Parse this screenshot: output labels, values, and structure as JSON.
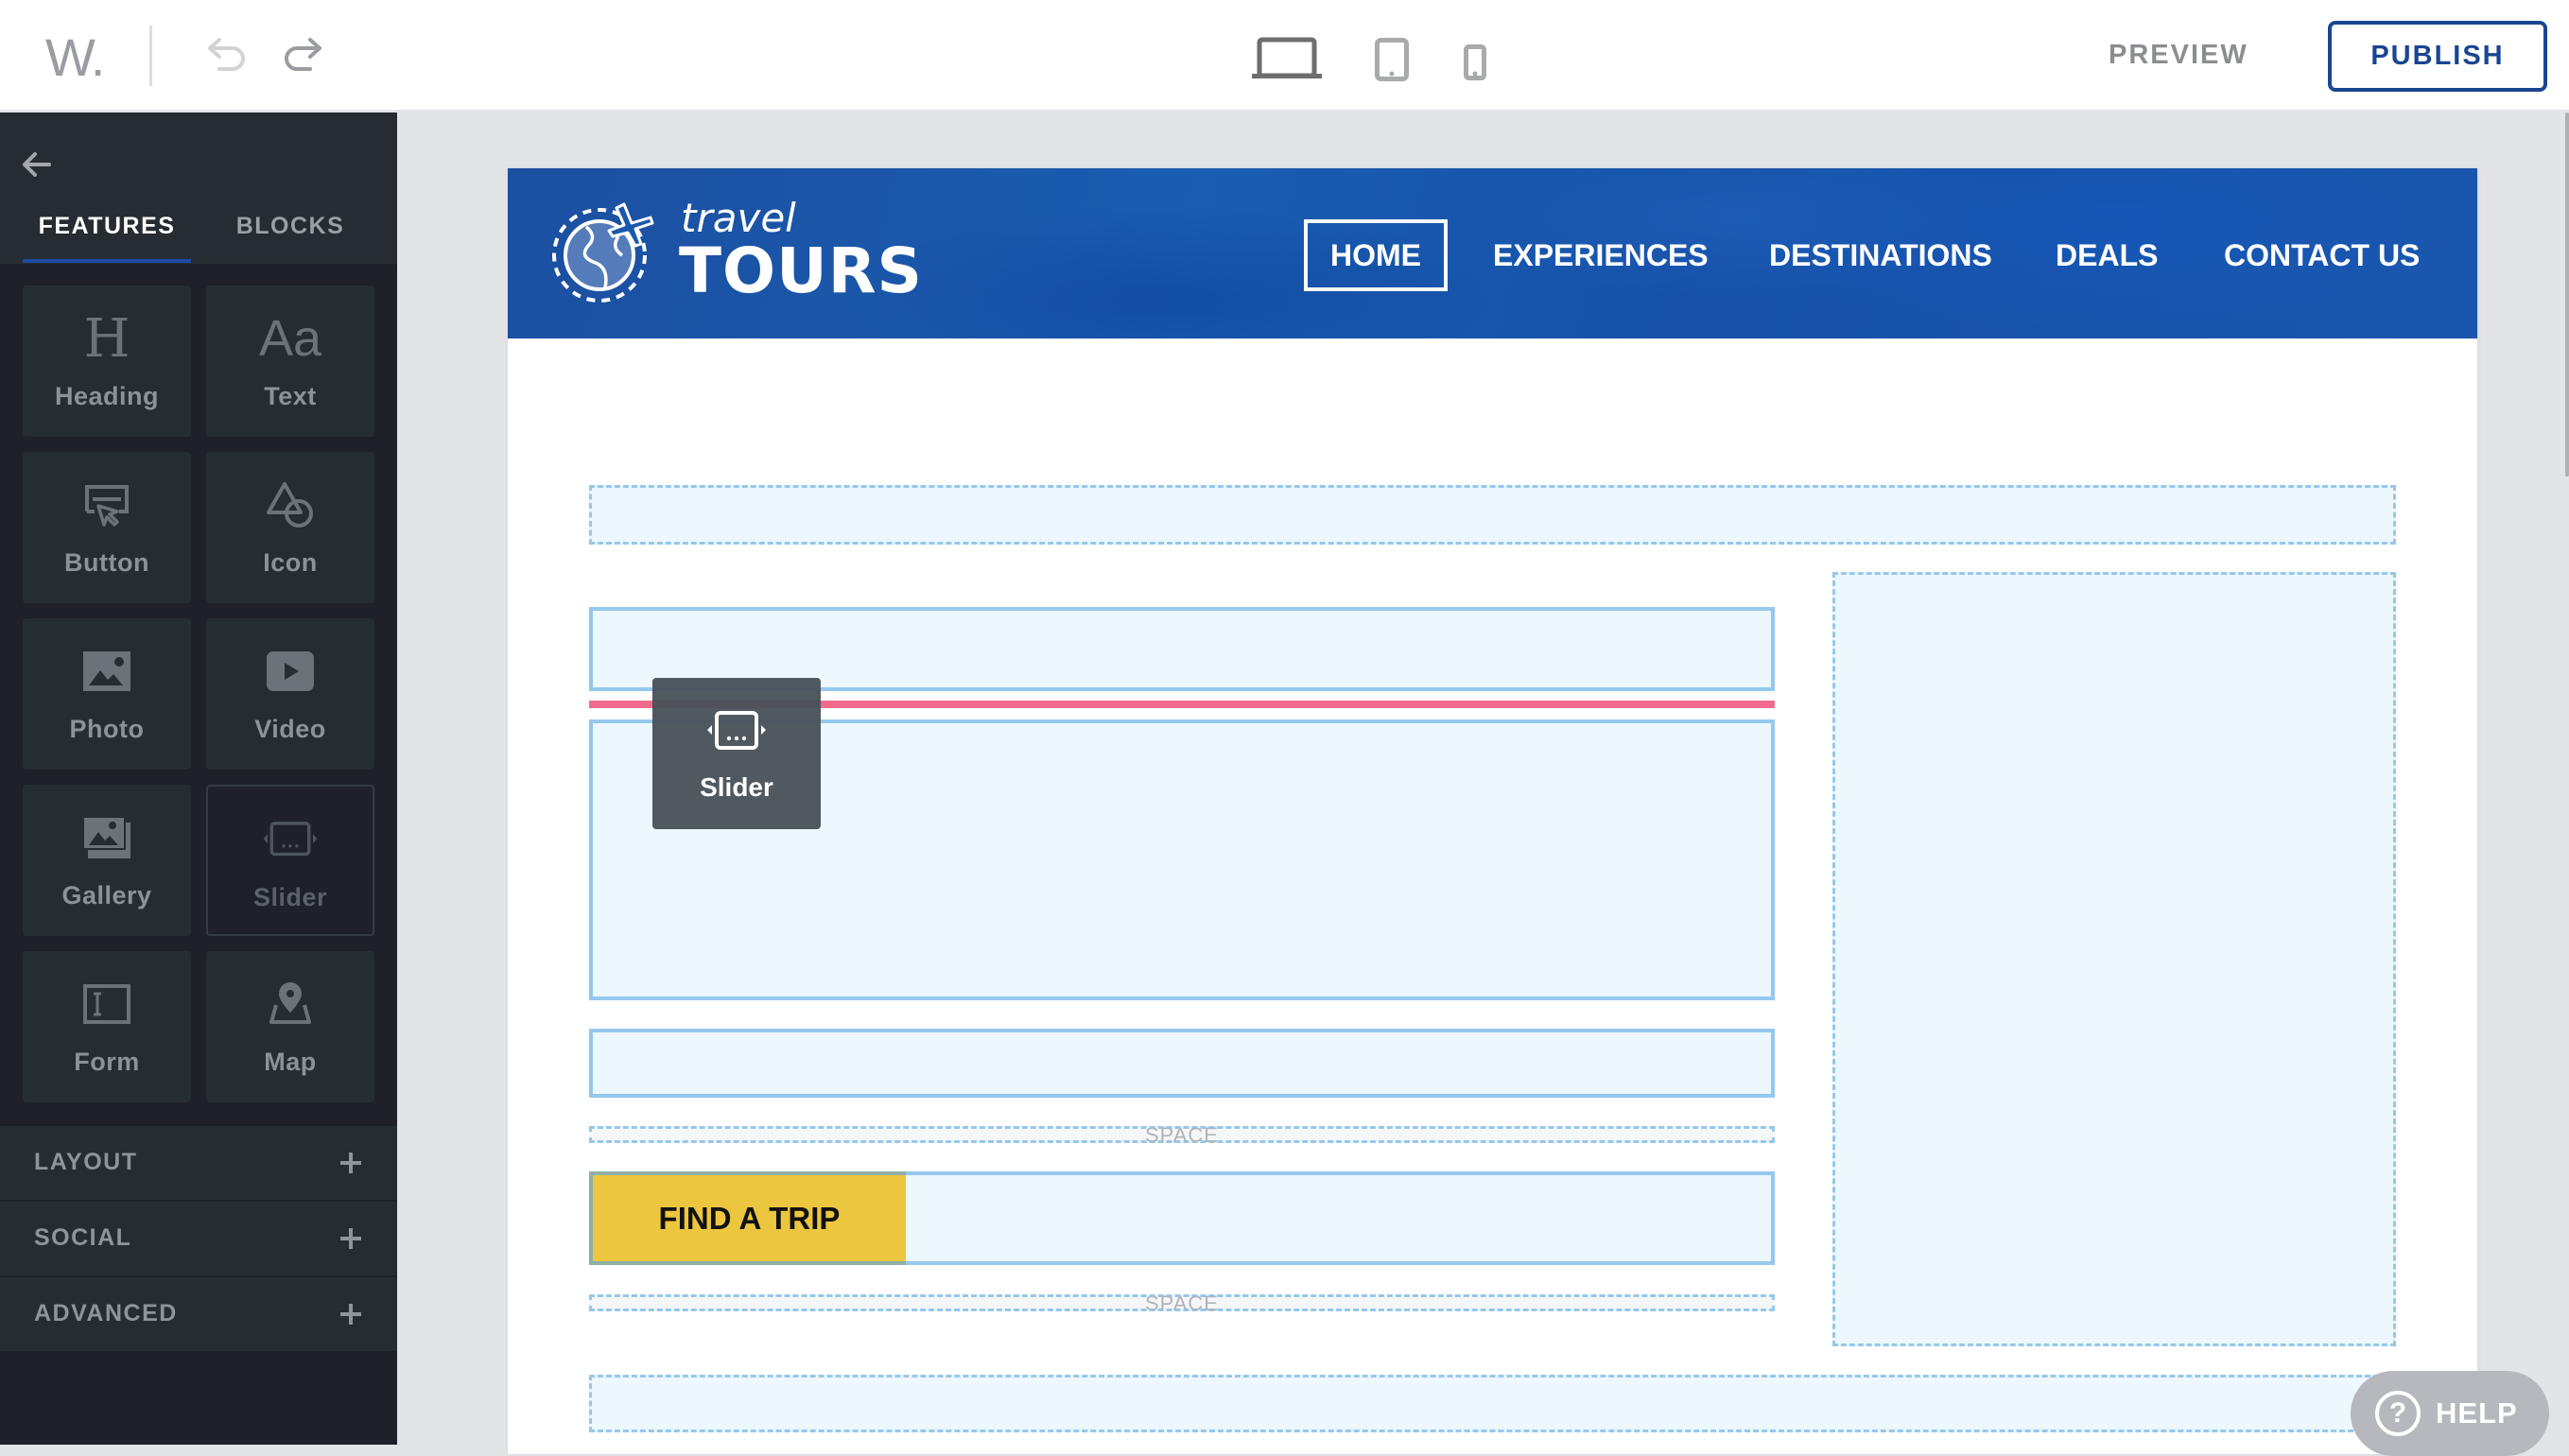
{
  "topbar": {
    "logo": "W.",
    "undo_icon": "undo-icon",
    "redo_icon": "redo-icon",
    "devices": [
      "desktop-icon",
      "tablet-icon",
      "phone-icon"
    ],
    "active_device": "desktop",
    "preview_label": "PREVIEW",
    "publish_label": "PUBLISH"
  },
  "sidebar": {
    "back_icon": "arrow-left-icon",
    "tabs": [
      {
        "label": "FEATURES",
        "active": true
      },
      {
        "label": "BLOCKS",
        "active": false
      }
    ],
    "tiles": [
      {
        "label": "Heading",
        "icon": "heading-icon"
      },
      {
        "label": "Text",
        "icon": "text-icon"
      },
      {
        "label": "Button",
        "icon": "button-icon"
      },
      {
        "label": "Icon",
        "icon": "shapes-icon"
      },
      {
        "label": "Photo",
        "icon": "photo-icon"
      },
      {
        "label": "Video",
        "icon": "video-icon"
      },
      {
        "label": "Gallery",
        "icon": "gallery-icon"
      },
      {
        "label": "Slider",
        "icon": "slider-icon",
        "state": "dragging"
      },
      {
        "label": "Form",
        "icon": "form-icon"
      },
      {
        "label": "Map",
        "icon": "map-pin-icon"
      }
    ],
    "sections": [
      {
        "label": "LAYOUT"
      },
      {
        "label": "SOCIAL"
      },
      {
        "label": "ADVANCED"
      }
    ]
  },
  "site": {
    "brand_small": "travel",
    "brand_large": "TOURS",
    "nav": [
      {
        "label": "HOME",
        "active": true
      },
      {
        "label": "EXPERIENCES"
      },
      {
        "label": "DESTINATIONS"
      },
      {
        "label": "DEALS"
      },
      {
        "label": "CONTACT US"
      }
    ],
    "spacer_label": "SPACE",
    "cta_label": "FIND A TRIP",
    "cta_color": "#ecc63f"
  },
  "drag": {
    "label": "Slider",
    "icon": "slider-icon"
  },
  "help": {
    "label": "HELP",
    "icon": "question-circle-icon"
  },
  "colors": {
    "accent": "#1a4591",
    "drop_indicator": "#f06b8e",
    "dropzone_border": "#95c8ee",
    "sidebar_bg": "#1e2128"
  }
}
